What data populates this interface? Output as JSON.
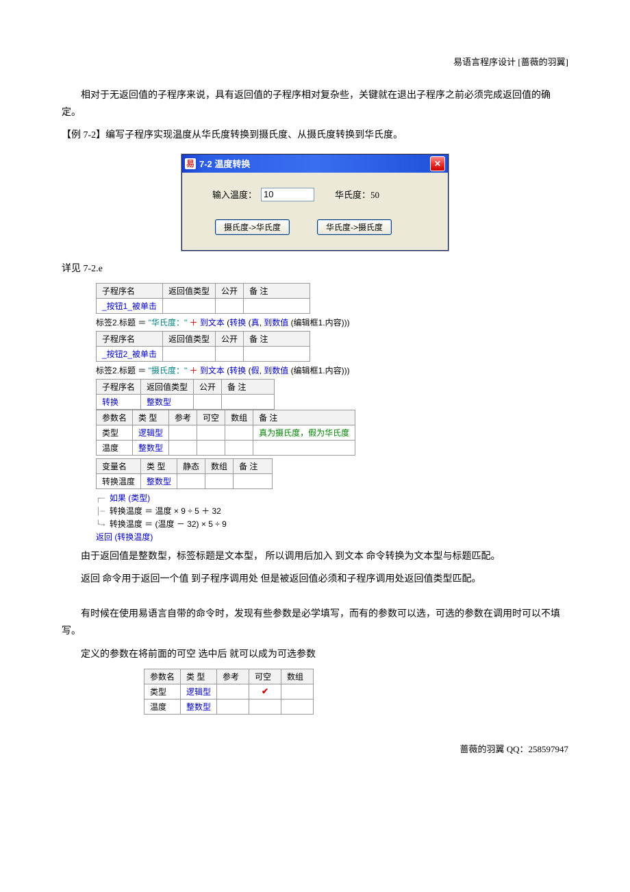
{
  "header": {
    "text": "易语言程序设计 [蔷薇的羽翼]"
  },
  "intro": {
    "p1": "相对于无返回值的子程序来说，具有返回值的子程序相对复杂些，关键就在退出子程序之前必须完成返回值的确定。",
    "example_label": "【例 7-2】编写子程序实现温度从华氏度转换到摄氏度、从摄氏度转换到华氏度。"
  },
  "window": {
    "title": "7-2 温度转换",
    "icon": "易",
    "input_label": "输入温度：",
    "input_value": "10",
    "result_label": "华氏度：50",
    "btn1": "摄氏度->华氏度",
    "btn2": "华氏度->摄氏度"
  },
  "see_label": "详见 7-2.e",
  "code": {
    "tbl_headers": {
      "sub_name": "子程序名",
      "ret_type": "返回值类型",
      "public": "公开",
      "remark": "备 注",
      "param_name": "参数名",
      "type": "类 型",
      "ref": "参考",
      "nullable": "可空",
      "array": "数组",
      "var_name": "变量名",
      "static": "静态"
    },
    "sub1_name": "_按钮1_被单击",
    "sub2_name": "_按钮2_被单击",
    "sub3_name": "转换",
    "sub3_ret": "整数型",
    "line1": {
      "assign": "标签2.标题 ＝ ",
      "str": "\"华氏度：\"",
      "plus": " ＋ ",
      "totext": "到文本 ",
      "lp": "(",
      "convert": "转换 ",
      "true": "真",
      "comma": ", ",
      "tonum": "到数值 ",
      "edit": "(编辑框1.内容)",
      "rp": ")"
    },
    "line2": {
      "assign": "标签2.标题 ＝ ",
      "str": "\"摄氏度：\"",
      "plus": " ＋ ",
      "totext": "到文本 ",
      "lp": "(",
      "convert": "转换 ",
      "false": "假",
      "comma": ", ",
      "tonum": "到数值 ",
      "edit": "(编辑框1.内容)",
      "rp": ")"
    },
    "params": {
      "p1_name": "类型",
      "p1_type": "逻辑型",
      "p1_remark": "真为摄氏度，假为华氏度",
      "p2_name": "温度",
      "p2_type": "整数型"
    },
    "vars": {
      "v1_name": "转换温度",
      "v1_type": "整数型"
    },
    "tree": {
      "if": "如果 (类型)",
      "br1": "转换温度 ＝ 温度 × 9 ÷ 5 ＋ 32",
      "br2": "转换温度 ＝ (温度 － 32) × 5 ÷ 9",
      "ret": "返回 (转换温度)"
    }
  },
  "body": {
    "p2": "由于返回值是整数型，标签标题是文本型， 所以调用后加入 到文本 命令转换为文本型与标题匹配。",
    "p3": "返回 命令用于返回一个值 到子程序调用处 但是被返回值必须和子程序调用处返回值类型匹配。",
    "p4": "有时候在使用易语言自带的命令时，发现有些参数是必学填写，而有的参数可以选，可选的参数在调用时可以不填写。",
    "p5": "定义的参数在将前面的可空 选中后 就可以成为可选参数"
  },
  "opt_table": {
    "h_name": "参数名",
    "h_type": "类 型",
    "h_ref": "参考",
    "h_null": "可空",
    "h_arr": "数组",
    "r1_name": "类型",
    "r1_type": "逻辑型",
    "r2_name": "温度",
    "r2_type": "整数型",
    "check": "✔"
  },
  "footer": {
    "text": "蔷薇的羽翼 QQ：258597947"
  }
}
